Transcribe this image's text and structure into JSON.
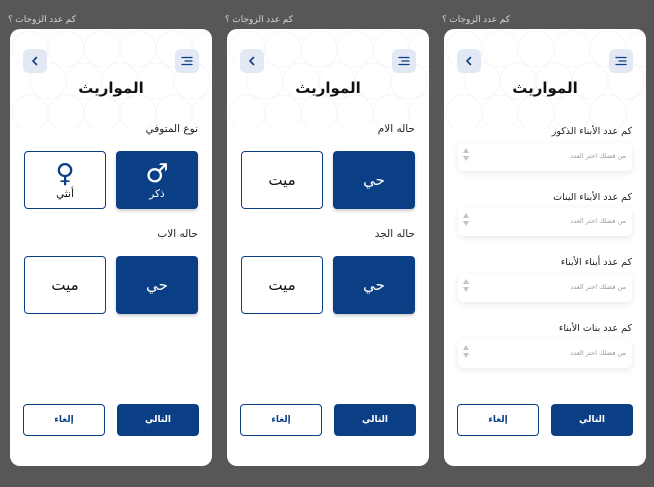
{
  "screens": [
    {
      "caption": "كم عدد الزوجات ؟",
      "title": "المواريث",
      "sections": [
        {
          "label": "نوع المتوفي",
          "options": [
            {
              "label": "ذكر",
              "icon": "male-symbol-icon",
              "glyph": "♂",
              "selected": true
            },
            {
              "label": "أنثي",
              "icon": "female-symbol-icon",
              "glyph": "♀",
              "selected": false
            }
          ]
        },
        {
          "label": "حاله الاب",
          "options": [
            {
              "label": "حي",
              "selected": true
            },
            {
              "label": "ميت",
              "selected": false
            }
          ]
        }
      ],
      "buttons": {
        "next": "التالي",
        "cancel": "إلغاء"
      }
    },
    {
      "caption": "كم عدد الزوجات ؟",
      "title": "المواريث",
      "sections": [
        {
          "label": "حاله الام",
          "options": [
            {
              "label": "حي",
              "selected": true
            },
            {
              "label": "ميت",
              "selected": false
            }
          ]
        },
        {
          "label": "حاله الجد",
          "options": [
            {
              "label": "حي",
              "selected": true
            },
            {
              "label": "ميت",
              "selected": false
            }
          ]
        }
      ],
      "buttons": {
        "next": "التالي",
        "cancel": "إلغاء"
      }
    },
    {
      "caption": "كم عدد الزوجات ؟",
      "title": "المواريث",
      "fields": [
        {
          "label": "كم عدد الأبناء الذكور",
          "placeholder": "من فضلك اختر العدد",
          "value": ""
        },
        {
          "label": "كم عدد الأبناء البنات",
          "placeholder": "من فضلك اختر العدد",
          "value": ""
        },
        {
          "label": "كم عدد أبناء الأبناء",
          "placeholder": "من فضلك اختر العدد",
          "value": ""
        },
        {
          "label": "كم عدد بنات الأبناء",
          "placeholder": "من فضلك اختر العدد",
          "value": ""
        }
      ],
      "buttons": {
        "next": "التالي",
        "cancel": "إلغاء"
      }
    }
  ],
  "icons": {
    "back": "chevron-left-icon",
    "menu": "menu-lines-icon"
  },
  "colors": {
    "primary": "#0b3f85",
    "canvas": "#575757",
    "icon_button_bg": "#e3e9f4",
    "card": "#ffffff"
  }
}
